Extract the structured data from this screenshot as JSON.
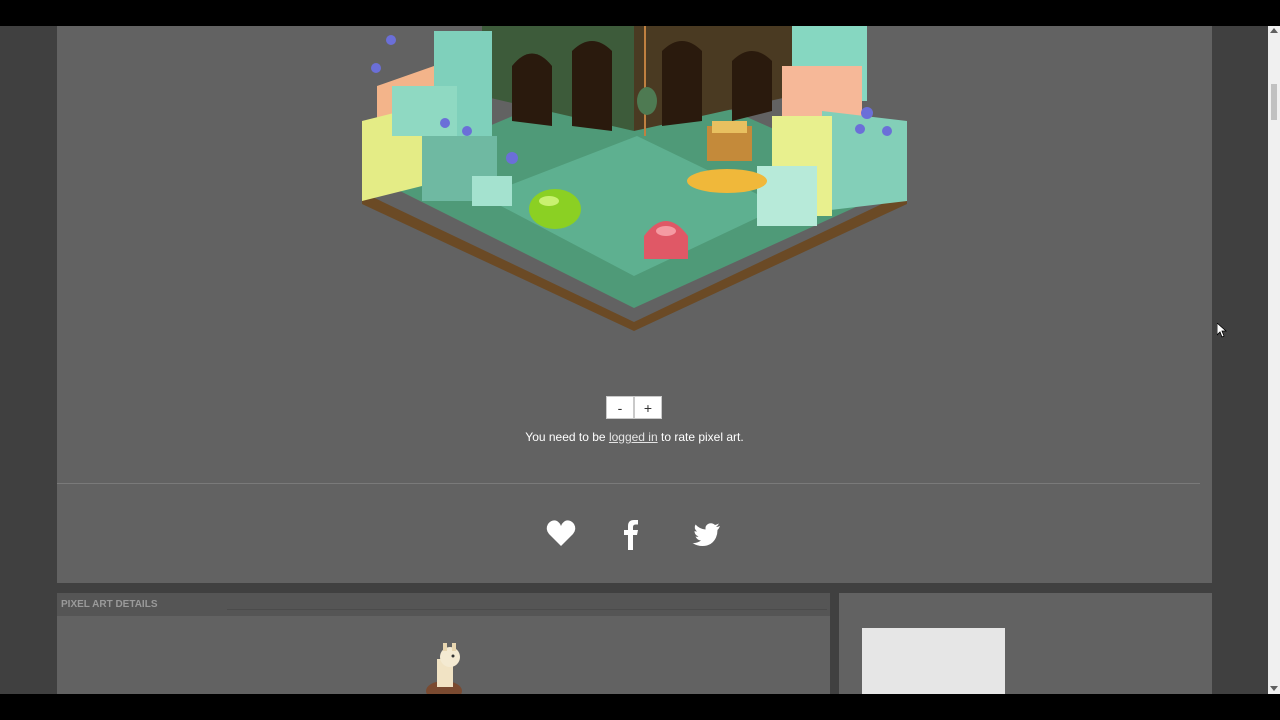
{
  "zoom": {
    "minus_label": "-",
    "plus_label": "+"
  },
  "rating": {
    "prefix": "You need to be ",
    "link_text": "logged in",
    "suffix": " to rate pixel art."
  },
  "social": {
    "icons": [
      "heart-icon",
      "facebook-icon",
      "twitter-icon"
    ]
  },
  "details": {
    "header": "PIXEL ART DETAILS"
  },
  "colors": {
    "panel": "#626262",
    "page_bg": "#404040",
    "icon": "#ffffff"
  }
}
